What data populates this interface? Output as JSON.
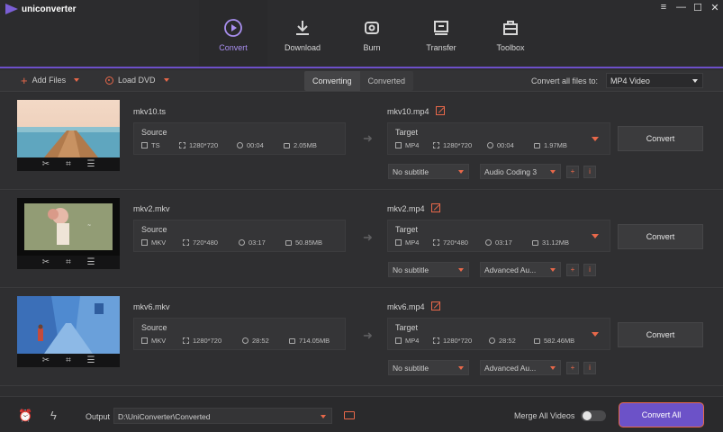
{
  "app": {
    "title": "uniconverter"
  },
  "window_controls": {
    "menu": "≡",
    "minimize": "—",
    "maximize": "☐",
    "close": "✕"
  },
  "nav": [
    {
      "label": "Convert",
      "icon": "convert-icon",
      "active": true
    },
    {
      "label": "Download",
      "icon": "download-icon",
      "active": false
    },
    {
      "label": "Burn",
      "icon": "burn-icon",
      "active": false
    },
    {
      "label": "Transfer",
      "icon": "transfer-icon",
      "active": false
    },
    {
      "label": "Toolbox",
      "icon": "toolbox-icon",
      "active": false
    }
  ],
  "toolbar": {
    "add_files": "Add Files",
    "load_dvd": "Load DVD",
    "tab_converting": "Converting",
    "tab_converted": "Converted",
    "convert_all_label": "Convert all files to:",
    "convert_all_value": "MP4 Video"
  },
  "files": [
    {
      "source_name": "mkv10.ts",
      "source_label": "Source",
      "source": {
        "format": "TS",
        "resolution": "1280*720",
        "duration": "00:04",
        "size": "2.05MB"
      },
      "target_name": "mkv10.mp4",
      "target_label": "Target",
      "target": {
        "format": "MP4",
        "resolution": "1280*720",
        "duration": "00:04",
        "size": "1.97MB"
      },
      "subtitle": "No subtitle",
      "audio": "Audio Coding 3",
      "convert": "Convert"
    },
    {
      "source_name": "mkv2.mkv",
      "source_label": "Source",
      "source": {
        "format": "MKV",
        "resolution": "720*480",
        "duration": "03:17",
        "size": "50.85MB"
      },
      "target_name": "mkv2.mp4",
      "target_label": "Target",
      "target": {
        "format": "MP4",
        "resolution": "720*480",
        "duration": "03:17",
        "size": "31.12MB"
      },
      "subtitle": "No subtitle",
      "audio": "Advanced Au...",
      "convert": "Convert"
    },
    {
      "source_name": "mkv6.mkv",
      "source_label": "Source",
      "source": {
        "format": "MKV",
        "resolution": "1280*720",
        "duration": "28:52",
        "size": "714.05MB"
      },
      "target_name": "mkv6.mp4",
      "target_label": "Target",
      "target": {
        "format": "MP4",
        "resolution": "1280*720",
        "duration": "28:52",
        "size": "582.46MB"
      },
      "subtitle": "No subtitle",
      "audio": "Advanced Au...",
      "convert": "Convert"
    }
  ],
  "thumb_tools": {
    "cut": "✂",
    "crop": "⌗",
    "effects": "☰"
  },
  "bottom": {
    "output_label": "Output",
    "output_path": "D:\\UniConverter\\Converted",
    "merge_label": "Merge All Videos",
    "merge_on": false,
    "convert_all": "Convert All"
  },
  "colors": {
    "accent": "#6c52c8",
    "highlight": "#e8684a",
    "nav_active": "#a98ff0"
  }
}
